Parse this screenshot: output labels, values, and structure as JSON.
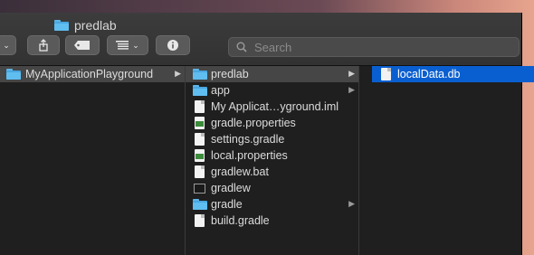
{
  "window": {
    "title": "predlab"
  },
  "toolbar": {
    "search_placeholder": "Search",
    "buttons": [
      {
        "name": "view-dropdown"
      },
      {
        "name": "share"
      },
      {
        "name": "tag"
      },
      {
        "name": "group-dropdown"
      },
      {
        "name": "info"
      }
    ]
  },
  "columns": [
    {
      "items": [
        {
          "label": "MyApplicationPlayground",
          "icon": "folder-icon",
          "has_children": true,
          "state": "selected-inactive"
        }
      ]
    },
    {
      "items": [
        {
          "label": "predlab",
          "icon": "folder-icon",
          "has_children": true,
          "state": "selected-inactive"
        },
        {
          "label": "app",
          "icon": "folder-icon",
          "has_children": true,
          "state": "normal"
        },
        {
          "label": "My Applicat…yground.iml",
          "icon": "document-icon",
          "has_children": false,
          "state": "normal"
        },
        {
          "label": "gradle.properties",
          "icon": "properties-file-icon",
          "has_children": false,
          "state": "normal"
        },
        {
          "label": "settings.gradle",
          "icon": "document-icon",
          "has_children": false,
          "state": "normal"
        },
        {
          "label": "local.properties",
          "icon": "properties-file-icon",
          "has_children": false,
          "state": "normal"
        },
        {
          "label": "gradlew.bat",
          "icon": "document-icon",
          "has_children": false,
          "state": "normal"
        },
        {
          "label": "gradlew",
          "icon": "terminal-executable-icon",
          "has_children": false,
          "state": "normal"
        },
        {
          "label": "gradle",
          "icon": "folder-icon",
          "has_children": true,
          "state": "normal"
        },
        {
          "label": "build.gradle",
          "icon": "document-icon",
          "has_children": false,
          "state": "normal"
        }
      ]
    },
    {
      "items": [
        {
          "label": "localData.db",
          "icon": "document-icon",
          "has_children": false,
          "state": "selected"
        }
      ]
    }
  ],
  "colors": {
    "selection_blue": "#0a5fd0",
    "selection_gray": "#464646",
    "folder_blue": "#5fbdf0",
    "background": "#1f1f1f"
  }
}
